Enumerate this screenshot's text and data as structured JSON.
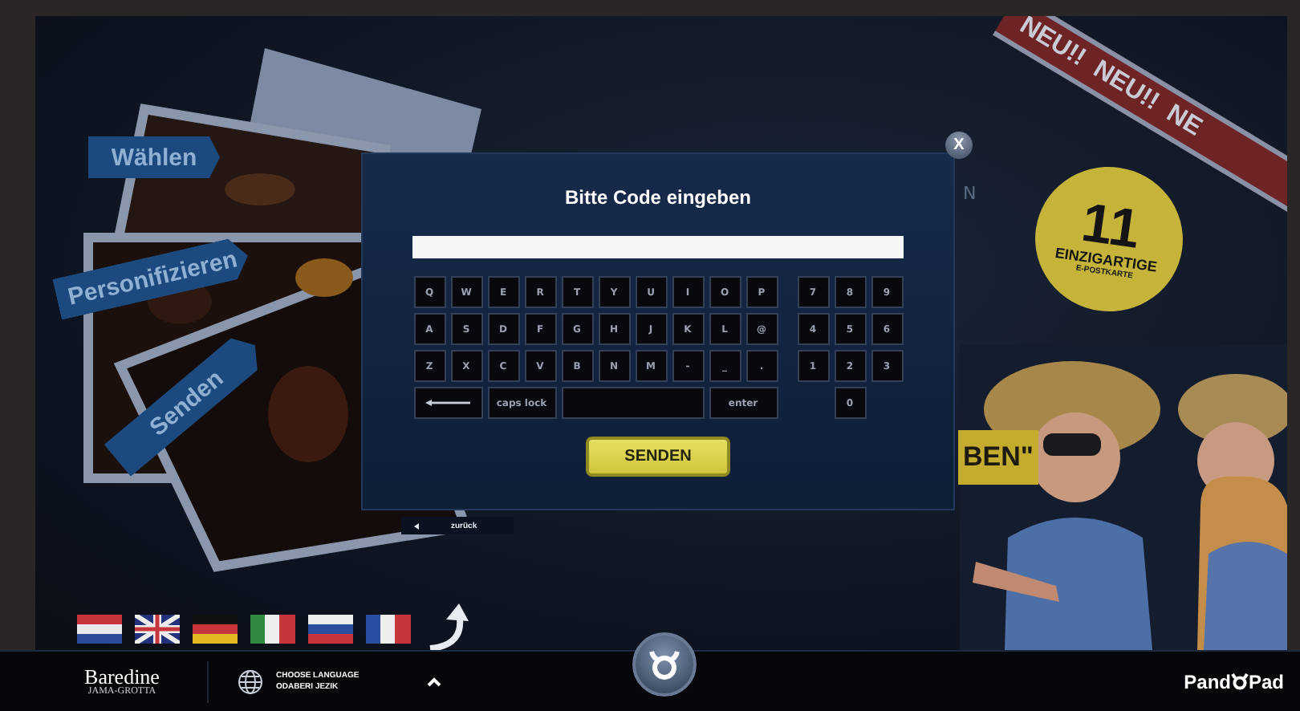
{
  "scene": {
    "steps": [
      {
        "label": "Wählen"
      },
      {
        "label": "Personifizieren"
      },
      {
        "label": "Senden"
      }
    ],
    "ribbon": "NEU!!  NEU!!  NE",
    "badge": {
      "number": "11",
      "line_1": "EINZIGARTIGE",
      "line_2": "E-POSTKARTE"
    },
    "sign": "BEN\"",
    "partial_letter": "N",
    "flags": [
      {
        "kind": "croatia"
      },
      {
        "kind": "uk"
      },
      {
        "kind": "germany"
      },
      {
        "kind": "italy"
      },
      {
        "kind": "russia"
      },
      {
        "kind": "france"
      }
    ]
  },
  "dialog": {
    "title": "Bitte Code eingeben",
    "close": "X",
    "letter_rows": [
      [
        "Q",
        "W",
        "E",
        "R",
        "T",
        "Y",
        "U",
        "I",
        "O",
        "P"
      ],
      [
        "A",
        "S",
        "D",
        "F",
        "G",
        "H",
        "J",
        "K",
        "L",
        "@"
      ],
      [
        "Z",
        "X",
        "C",
        "V",
        "B",
        "N",
        "M",
        "-",
        "_",
        "."
      ]
    ],
    "special_keys": [
      {
        "kind": "backspace"
      },
      {
        "kind": "caps",
        "label": "caps lock"
      },
      {
        "kind": "space"
      },
      {
        "kind": "enter",
        "label": "enter"
      }
    ],
    "number_rows": [
      [
        "7",
        "8",
        "9"
      ],
      [
        "4",
        "5",
        "6"
      ],
      [
        "1",
        "2",
        "3"
      ],
      [
        "0"
      ]
    ],
    "submit": "SENDEN",
    "back": "zurück"
  },
  "bottom_bar": {
    "logo": {
      "name": "Baredine",
      "subtitle": "JAMA-GROTTA"
    },
    "language": {
      "line_1": "CHOOSE LANGUAGE",
      "line_2": "ODABERI JEZIK"
    },
    "brand": {
      "left": "Pand",
      "right": "Pad"
    }
  }
}
